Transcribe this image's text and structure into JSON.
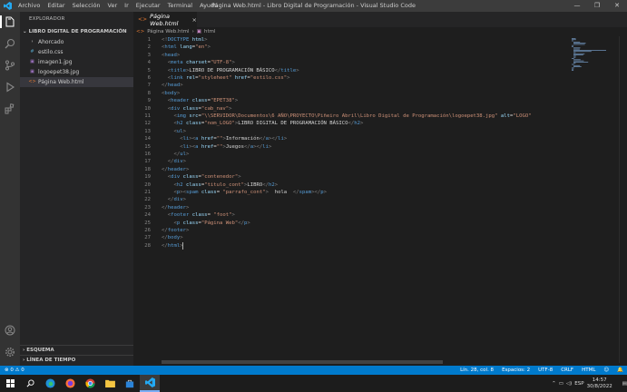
{
  "titlebar": {
    "menu": [
      "Archivo",
      "Editar",
      "Selección",
      "Ver",
      "Ir",
      "Ejecutar",
      "Terminal",
      "Ayuda"
    ],
    "window_title": "Página Web.html - Libro Digital de Programación - Visual Studio Code",
    "controls": {
      "minimize": "—",
      "maximize": "❐",
      "close": "✕"
    }
  },
  "sidebar": {
    "title": "EXPLORADOR",
    "folder": "LIBRO DIGITAL DE PROGRAMACIÓN",
    "items": [
      {
        "label": "Ahorcado",
        "type": "folder"
      },
      {
        "label": "estilo.css",
        "type": "css"
      },
      {
        "label": "imagen1.jpg",
        "type": "image"
      },
      {
        "label": "logoepet38.jpg",
        "type": "image"
      },
      {
        "label": "Página Web.html",
        "type": "html"
      }
    ],
    "outline": "ESQUEMA",
    "timeline": "LÍNEA DE TIEMPO"
  },
  "tab": {
    "label": "Página Web.html",
    "close": "×"
  },
  "breadcrumb": [
    "Página Web.html",
    "html"
  ],
  "editor": {
    "lines": [
      [
        [
          "p",
          "<!"
        ],
        [
          "t",
          "DOCTYPE"
        ],
        [
          "a",
          " html"
        ],
        [
          "p",
          ">"
        ]
      ],
      [
        [
          "p",
          "<"
        ],
        [
          "t",
          "html"
        ],
        [
          "a",
          " lang"
        ],
        [
          "x",
          "="
        ],
        [
          "s",
          "\"en\""
        ],
        [
          "p",
          ">"
        ]
      ],
      [
        [
          "p",
          "<"
        ],
        [
          "t",
          "head"
        ],
        [
          "p",
          ">"
        ]
      ],
      [
        [
          "x",
          "  "
        ],
        [
          "p",
          "<"
        ],
        [
          "t",
          "meta"
        ],
        [
          "a",
          " charset"
        ],
        [
          "x",
          "="
        ],
        [
          "s",
          "\"UTF-8\""
        ],
        [
          "p",
          ">"
        ]
      ],
      [
        [
          "x",
          "  "
        ],
        [
          "p",
          "<"
        ],
        [
          "t",
          "title"
        ],
        [
          "p",
          ">"
        ],
        [
          "x",
          "LIBRO DE PROGRAMACIÓN BÁSICO"
        ],
        [
          "p",
          "</"
        ],
        [
          "t",
          "title"
        ],
        [
          "p",
          ">"
        ]
      ],
      [
        [
          "x",
          "  "
        ],
        [
          "p",
          "<"
        ],
        [
          "t",
          "link"
        ],
        [
          "a",
          " rel"
        ],
        [
          "x",
          "="
        ],
        [
          "s",
          "\"styleheet\""
        ],
        [
          "a",
          " href"
        ],
        [
          "x",
          "="
        ],
        [
          "s",
          "\"estilo.css\""
        ],
        [
          "p",
          ">"
        ]
      ],
      [
        [
          "p",
          "</"
        ],
        [
          "t",
          "head"
        ],
        [
          "p",
          ">"
        ]
      ],
      [
        [
          "p",
          "<"
        ],
        [
          "t",
          "body"
        ],
        [
          "p",
          ">"
        ]
      ],
      [
        [
          "x",
          "  "
        ],
        [
          "p",
          "<"
        ],
        [
          "t",
          "header"
        ],
        [
          "a",
          " class"
        ],
        [
          "x",
          "="
        ],
        [
          "s",
          "\"EPET38\""
        ],
        [
          "p",
          ">"
        ]
      ],
      [
        [
          "x",
          "  "
        ],
        [
          "p",
          "<"
        ],
        [
          "t",
          "div"
        ],
        [
          "a",
          " class"
        ],
        [
          "x",
          "="
        ],
        [
          "s",
          "\"cab_nav\""
        ],
        [
          "p",
          ">"
        ]
      ],
      [
        [
          "x",
          "    "
        ],
        [
          "p",
          "<"
        ],
        [
          "t",
          "img"
        ],
        [
          "a",
          " src"
        ],
        [
          "x",
          "="
        ],
        [
          "s",
          "\"\\\\SERVIDOR\\Documentos\\6 AÑO\\PROYECTO\\Piñeiro Abril\\Libro Digital de Programación\\logoepet38.jpg\""
        ],
        [
          "a",
          " alt"
        ],
        [
          "x",
          "="
        ],
        [
          "s",
          "\"LOGO\""
        ]
      ],
      [
        [
          "x",
          "    "
        ],
        [
          "p",
          "<"
        ],
        [
          "t",
          "h2"
        ],
        [
          "a",
          " class"
        ],
        [
          "x",
          "="
        ],
        [
          "s",
          "\"nom_LOGO\""
        ],
        [
          "p",
          ">"
        ],
        [
          "x",
          "LIBRO DIGITAL DE PROGRAMACIÓN BÁSICO"
        ],
        [
          "p",
          "</"
        ],
        [
          "t",
          "h2"
        ],
        [
          "p",
          ">"
        ]
      ],
      [
        [
          "x",
          "    "
        ],
        [
          "p",
          "<"
        ],
        [
          "t",
          "ul"
        ],
        [
          "p",
          ">"
        ]
      ],
      [
        [
          "x",
          "      "
        ],
        [
          "p",
          "<"
        ],
        [
          "t",
          "li"
        ],
        [
          "p",
          "><"
        ],
        [
          "t",
          "a"
        ],
        [
          "a",
          " href"
        ],
        [
          "x",
          "="
        ],
        [
          "s",
          "\"\""
        ],
        [
          "p",
          ">"
        ],
        [
          "x",
          "Información"
        ],
        [
          "p",
          "</"
        ],
        [
          "t",
          "a"
        ],
        [
          "p",
          "></"
        ],
        [
          "t",
          "li"
        ],
        [
          "p",
          ">"
        ]
      ],
      [
        [
          "x",
          "      "
        ],
        [
          "p",
          "<"
        ],
        [
          "t",
          "li"
        ],
        [
          "p",
          "><"
        ],
        [
          "t",
          "a"
        ],
        [
          "a",
          " href"
        ],
        [
          "x",
          "="
        ],
        [
          "s",
          "\"\""
        ],
        [
          "p",
          ">"
        ],
        [
          "x",
          "Juegos"
        ],
        [
          "p",
          "</"
        ],
        [
          "t",
          "a"
        ],
        [
          "p",
          "></"
        ],
        [
          "t",
          "li"
        ],
        [
          "p",
          ">"
        ]
      ],
      [
        [
          "x",
          "    "
        ],
        [
          "p",
          "</"
        ],
        [
          "t",
          "ul"
        ],
        [
          "p",
          ">"
        ]
      ],
      [
        [
          "x",
          "  "
        ],
        [
          "p",
          "</"
        ],
        [
          "t",
          "div"
        ],
        [
          "p",
          ">"
        ]
      ],
      [
        [
          "p",
          "</"
        ],
        [
          "t",
          "header"
        ],
        [
          "p",
          ">"
        ]
      ],
      [
        [
          "x",
          "  "
        ],
        [
          "p",
          "<"
        ],
        [
          "t",
          "div"
        ],
        [
          "a",
          " class"
        ],
        [
          "x",
          "="
        ],
        [
          "s",
          "\"contenedor\""
        ],
        [
          "p",
          ">"
        ]
      ],
      [
        [
          "x",
          "    "
        ],
        [
          "p",
          "<"
        ],
        [
          "t",
          "h2"
        ],
        [
          "a",
          " class"
        ],
        [
          "x",
          "="
        ],
        [
          "s",
          "\"titulo_cont\""
        ],
        [
          "p",
          ">"
        ],
        [
          "x",
          "LIBRO"
        ],
        [
          "p",
          "</"
        ],
        [
          "t",
          "h2"
        ],
        [
          "p",
          ">"
        ]
      ],
      [
        [
          "x",
          "    "
        ],
        [
          "p",
          "<"
        ],
        [
          "t",
          "p"
        ],
        [
          "p",
          "><"
        ],
        [
          "t",
          "spam"
        ],
        [
          "a",
          " class"
        ],
        [
          "x",
          "= "
        ],
        [
          "s",
          "\"parrafo_cont\""
        ],
        [
          "p",
          ">"
        ],
        [
          "x",
          "  hola  "
        ],
        [
          "p",
          "</"
        ],
        [
          "t",
          "spam"
        ],
        [
          "p",
          "></"
        ],
        [
          "t",
          "p"
        ],
        [
          "p",
          ">"
        ]
      ],
      [
        [
          "x",
          "  "
        ],
        [
          "p",
          "</"
        ],
        [
          "t",
          "div"
        ],
        [
          "p",
          ">"
        ]
      ],
      [
        [
          "p",
          "</"
        ],
        [
          "t",
          "header"
        ],
        [
          "p",
          ">"
        ]
      ],
      [
        [
          "x",
          "  "
        ],
        [
          "p",
          "<"
        ],
        [
          "t",
          "footer"
        ],
        [
          "a",
          " class"
        ],
        [
          "x",
          "= "
        ],
        [
          "s",
          "\"foot\""
        ],
        [
          "p",
          ">"
        ]
      ],
      [
        [
          "x",
          "    "
        ],
        [
          "p",
          "<"
        ],
        [
          "t",
          "p"
        ],
        [
          "a",
          " class"
        ],
        [
          "x",
          "="
        ],
        [
          "s",
          "\"Página Web\""
        ],
        [
          "p",
          "</"
        ],
        [
          "t",
          "p"
        ],
        [
          "p",
          ">"
        ]
      ],
      [
        [
          "p",
          "</"
        ],
        [
          "t",
          "footer"
        ],
        [
          "p",
          ">"
        ]
      ],
      [
        [
          "p",
          "</"
        ],
        [
          "t",
          "body"
        ],
        [
          "p",
          ">"
        ]
      ],
      [
        [
          "p",
          "</"
        ],
        [
          "t",
          "html"
        ],
        [
          "p",
          ">"
        ]
      ]
    ]
  },
  "statusbar": {
    "problems": "⊗ 0 ⚠ 0",
    "position": "Lín. 28, col. 8",
    "spaces": "Espacios: 2",
    "encoding": "UTF-8",
    "eol": "CRLF",
    "language": "HTML",
    "feedback": "☺",
    "bell": "🔔"
  },
  "taskbar": {
    "time": "14:57",
    "date": "30/8/2022",
    "lang": "ESP"
  },
  "colors": {
    "accent": "#007acc",
    "editor_bg": "#1e1e1e",
    "sidebar_bg": "#252526",
    "activity_bg": "#333333"
  }
}
